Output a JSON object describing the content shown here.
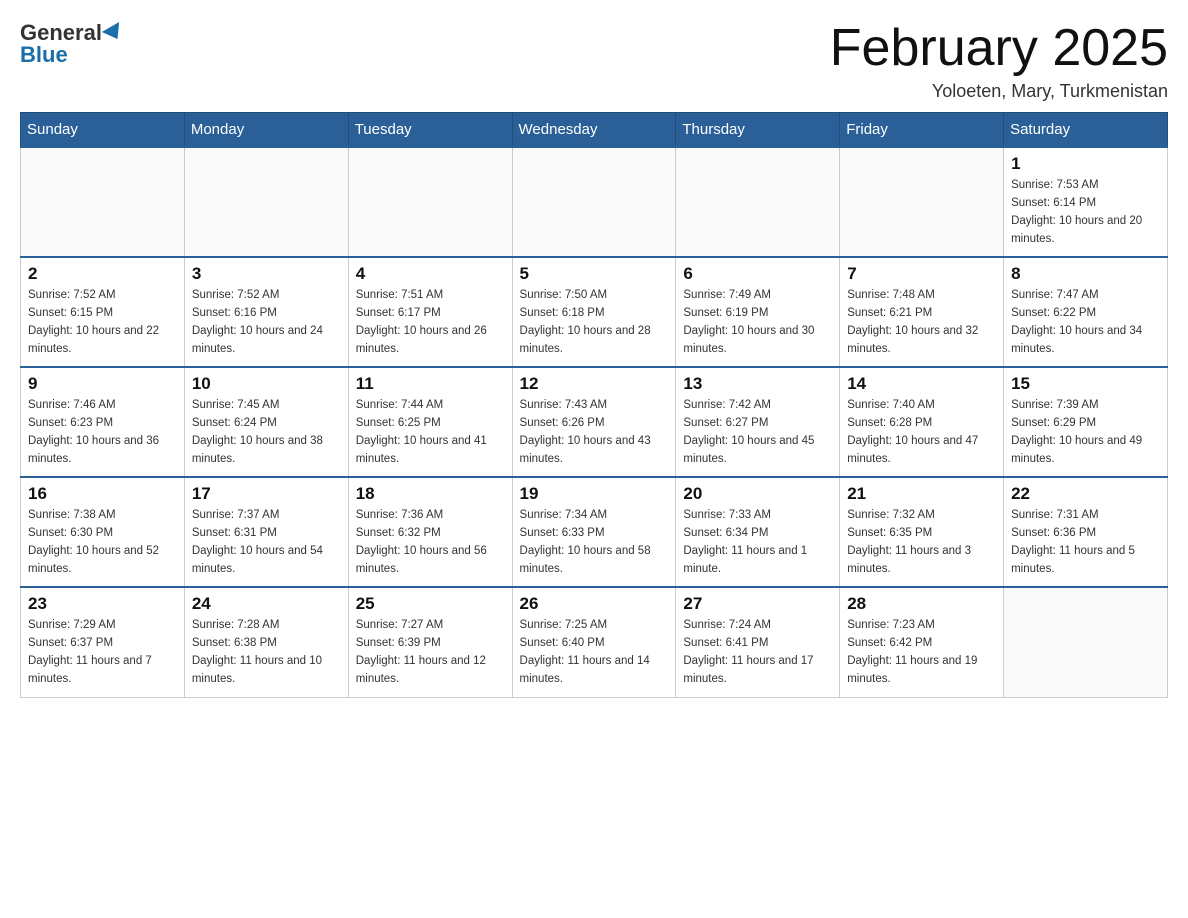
{
  "header": {
    "logo_general": "General",
    "logo_blue": "Blue",
    "month_title": "February 2025",
    "location": "Yoloeten, Mary, Turkmenistan"
  },
  "days_of_week": [
    "Sunday",
    "Monday",
    "Tuesday",
    "Wednesday",
    "Thursday",
    "Friday",
    "Saturday"
  ],
  "weeks": [
    [
      {
        "day": "",
        "info": ""
      },
      {
        "day": "",
        "info": ""
      },
      {
        "day": "",
        "info": ""
      },
      {
        "day": "",
        "info": ""
      },
      {
        "day": "",
        "info": ""
      },
      {
        "day": "",
        "info": ""
      },
      {
        "day": "1",
        "info": "Sunrise: 7:53 AM\nSunset: 6:14 PM\nDaylight: 10 hours and 20 minutes."
      }
    ],
    [
      {
        "day": "2",
        "info": "Sunrise: 7:52 AM\nSunset: 6:15 PM\nDaylight: 10 hours and 22 minutes."
      },
      {
        "day": "3",
        "info": "Sunrise: 7:52 AM\nSunset: 6:16 PM\nDaylight: 10 hours and 24 minutes."
      },
      {
        "day": "4",
        "info": "Sunrise: 7:51 AM\nSunset: 6:17 PM\nDaylight: 10 hours and 26 minutes."
      },
      {
        "day": "5",
        "info": "Sunrise: 7:50 AM\nSunset: 6:18 PM\nDaylight: 10 hours and 28 minutes."
      },
      {
        "day": "6",
        "info": "Sunrise: 7:49 AM\nSunset: 6:19 PM\nDaylight: 10 hours and 30 minutes."
      },
      {
        "day": "7",
        "info": "Sunrise: 7:48 AM\nSunset: 6:21 PM\nDaylight: 10 hours and 32 minutes."
      },
      {
        "day": "8",
        "info": "Sunrise: 7:47 AM\nSunset: 6:22 PM\nDaylight: 10 hours and 34 minutes."
      }
    ],
    [
      {
        "day": "9",
        "info": "Sunrise: 7:46 AM\nSunset: 6:23 PM\nDaylight: 10 hours and 36 minutes."
      },
      {
        "day": "10",
        "info": "Sunrise: 7:45 AM\nSunset: 6:24 PM\nDaylight: 10 hours and 38 minutes."
      },
      {
        "day": "11",
        "info": "Sunrise: 7:44 AM\nSunset: 6:25 PM\nDaylight: 10 hours and 41 minutes."
      },
      {
        "day": "12",
        "info": "Sunrise: 7:43 AM\nSunset: 6:26 PM\nDaylight: 10 hours and 43 minutes."
      },
      {
        "day": "13",
        "info": "Sunrise: 7:42 AM\nSunset: 6:27 PM\nDaylight: 10 hours and 45 minutes."
      },
      {
        "day": "14",
        "info": "Sunrise: 7:40 AM\nSunset: 6:28 PM\nDaylight: 10 hours and 47 minutes."
      },
      {
        "day": "15",
        "info": "Sunrise: 7:39 AM\nSunset: 6:29 PM\nDaylight: 10 hours and 49 minutes."
      }
    ],
    [
      {
        "day": "16",
        "info": "Sunrise: 7:38 AM\nSunset: 6:30 PM\nDaylight: 10 hours and 52 minutes."
      },
      {
        "day": "17",
        "info": "Sunrise: 7:37 AM\nSunset: 6:31 PM\nDaylight: 10 hours and 54 minutes."
      },
      {
        "day": "18",
        "info": "Sunrise: 7:36 AM\nSunset: 6:32 PM\nDaylight: 10 hours and 56 minutes."
      },
      {
        "day": "19",
        "info": "Sunrise: 7:34 AM\nSunset: 6:33 PM\nDaylight: 10 hours and 58 minutes."
      },
      {
        "day": "20",
        "info": "Sunrise: 7:33 AM\nSunset: 6:34 PM\nDaylight: 11 hours and 1 minute."
      },
      {
        "day": "21",
        "info": "Sunrise: 7:32 AM\nSunset: 6:35 PM\nDaylight: 11 hours and 3 minutes."
      },
      {
        "day": "22",
        "info": "Sunrise: 7:31 AM\nSunset: 6:36 PM\nDaylight: 11 hours and 5 minutes."
      }
    ],
    [
      {
        "day": "23",
        "info": "Sunrise: 7:29 AM\nSunset: 6:37 PM\nDaylight: 11 hours and 7 minutes."
      },
      {
        "day": "24",
        "info": "Sunrise: 7:28 AM\nSunset: 6:38 PM\nDaylight: 11 hours and 10 minutes."
      },
      {
        "day": "25",
        "info": "Sunrise: 7:27 AM\nSunset: 6:39 PM\nDaylight: 11 hours and 12 minutes."
      },
      {
        "day": "26",
        "info": "Sunrise: 7:25 AM\nSunset: 6:40 PM\nDaylight: 11 hours and 14 minutes."
      },
      {
        "day": "27",
        "info": "Sunrise: 7:24 AM\nSunset: 6:41 PM\nDaylight: 11 hours and 17 minutes."
      },
      {
        "day": "28",
        "info": "Sunrise: 7:23 AM\nSunset: 6:42 PM\nDaylight: 11 hours and 19 minutes."
      },
      {
        "day": "",
        "info": ""
      }
    ]
  ]
}
